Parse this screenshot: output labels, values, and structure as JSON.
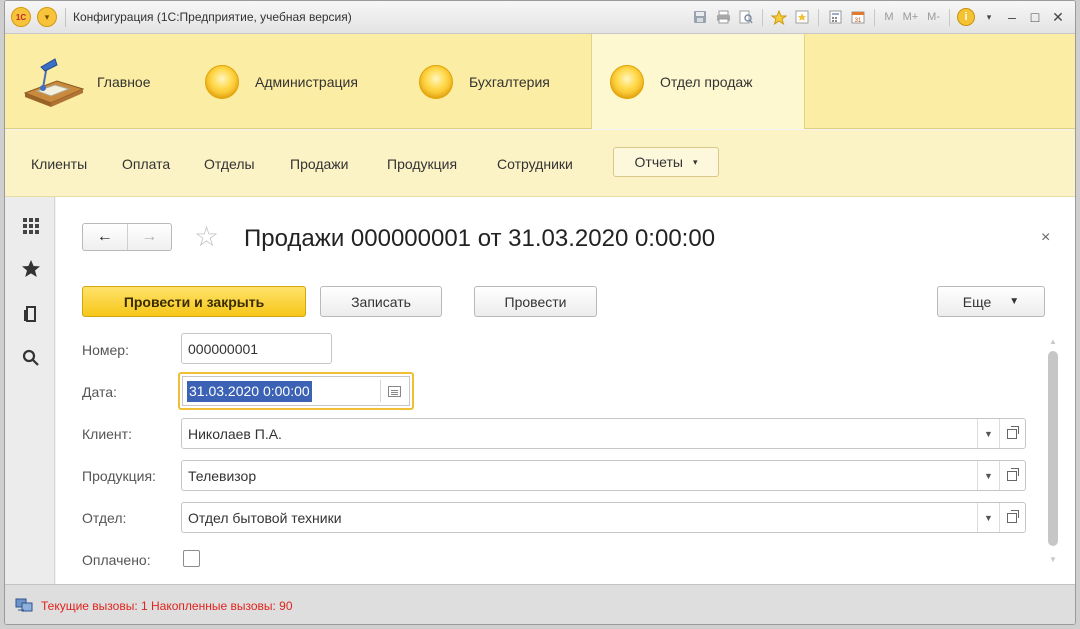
{
  "window": {
    "title": "Конфигурация  (1С:Предприятие, учебная версия)",
    "logo_text": "1С",
    "toolbar_text": {
      "m": "M",
      "m_plus": "M+",
      "m_minus": "M-"
    },
    "icons": [
      "save-icon",
      "print-icon",
      "preview-icon",
      "favorites-icon",
      "bookmark-icon",
      "calculator-icon",
      "calendar-icon",
      "info-icon",
      "minimize-icon",
      "maximize-icon",
      "close-icon"
    ]
  },
  "sections": [
    {
      "label": "Главное",
      "icon": "desk-icon"
    },
    {
      "label": "Администрация",
      "icon": "section-orb-icon"
    },
    {
      "label": "Бухгалтерия",
      "icon": "section-orb-icon"
    },
    {
      "label": "Отдел продаж",
      "icon": "section-orb-icon",
      "active": true
    }
  ],
  "nav": {
    "items": [
      "Клиенты",
      "Оплата",
      "Отделы",
      "Продажи",
      "Продукция",
      "Сотрудники"
    ],
    "reports_label": "Отчеты"
  },
  "left_toolbar": [
    "apps-grid-icon",
    "star-icon",
    "history-icon",
    "search-icon"
  ],
  "form": {
    "title": "Продажи 000000001 от 31.03.2020 0:00:00",
    "close_glyph": "×",
    "buttons": {
      "post_close": "Провести и закрыть",
      "save": "Записать",
      "post": "Провести",
      "more": "Еще"
    },
    "fields": {
      "number": {
        "label": "Номер:",
        "value": "000000001"
      },
      "date": {
        "label": "Дата:",
        "value": "31.03.2020  0:00:00"
      },
      "client": {
        "label": "Клиент:",
        "value": "Николаев П.А."
      },
      "product": {
        "label": "Продукция:",
        "value": "Телевизор"
      },
      "department": {
        "label": "Отдел:",
        "value": "Отдел бытовой техники"
      },
      "paid": {
        "label": "Оплачено:",
        "checked": false
      }
    }
  },
  "status": {
    "text": "Текущие вызовы: 1   Накопленные вызовы: 90",
    "color": "#e0231c"
  },
  "colors": {
    "sections_bg": "#fbeda3",
    "nav_bg": "#fbf2c6",
    "primary_button": "#f6c719",
    "focus_border": "#f0bf36",
    "selection": "#3b62b4"
  }
}
